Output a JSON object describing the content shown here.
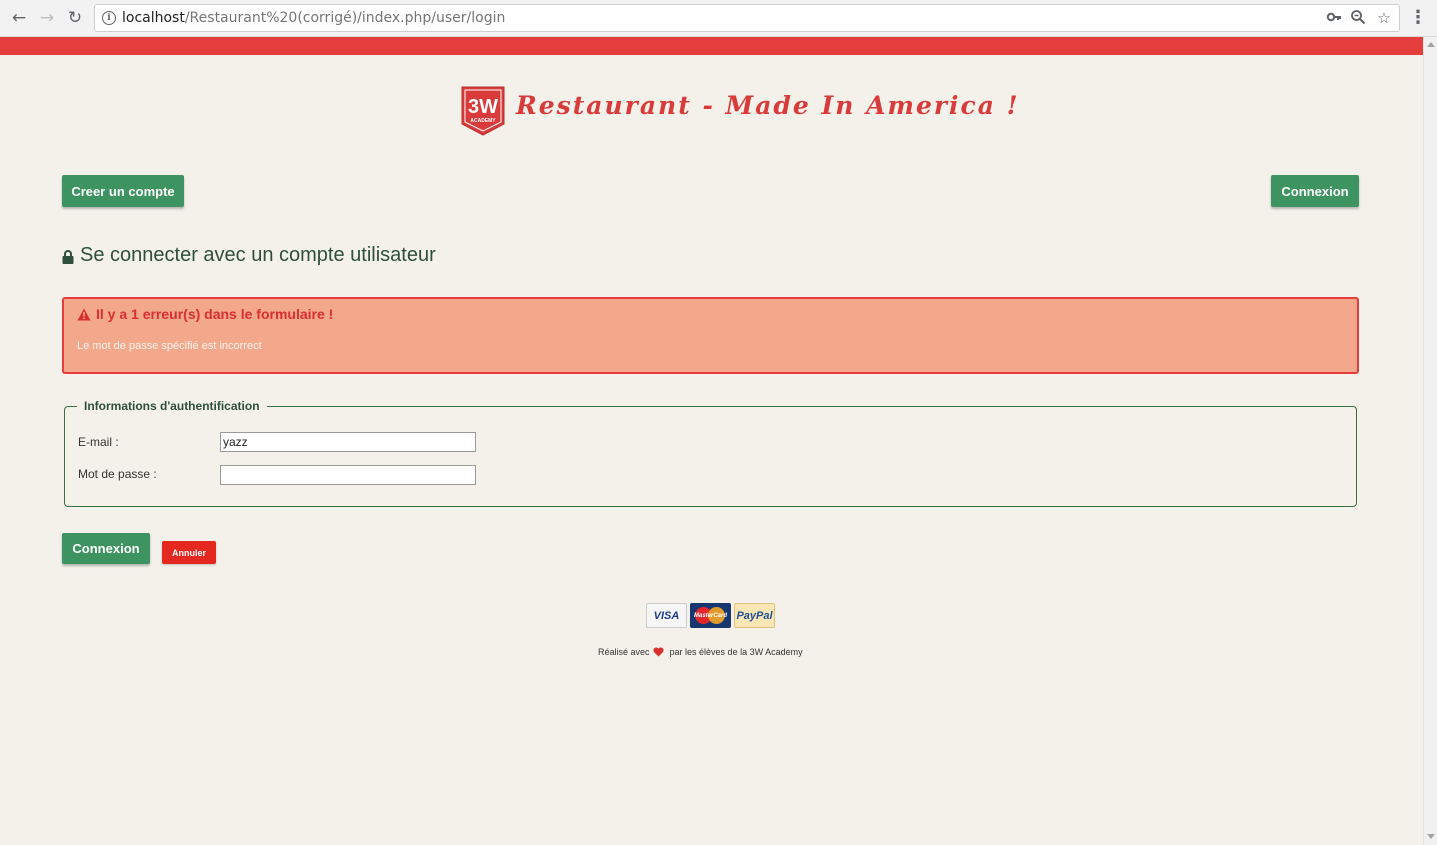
{
  "browser": {
    "url_host": "localhost",
    "url_path": "/Restaurant%20(corrigé)/index.php/user/login"
  },
  "header": {
    "logo_text": "3W",
    "logo_subtext": "ACADEMY",
    "title": "Restaurant - Made In America !"
  },
  "nav": {
    "create_account_label": "Creer un compte",
    "login_label": "Connexion"
  },
  "page": {
    "heading": "Se connecter avec un compte utilisateur"
  },
  "error": {
    "title": "Il y a 1 erreur(s) dans le formulaire !",
    "message": "Le mot de passe spécifié est incorrect"
  },
  "form": {
    "legend": "Informations d'authentification",
    "email_label": "E-mail :",
    "email_value": "yazz",
    "password_label": "Mot de passe :",
    "password_value": "",
    "submit_label": "Connexion",
    "cancel_label": "Annuler"
  },
  "footer": {
    "payments": [
      "VISA",
      "MasterCard",
      "PayPal"
    ],
    "credit_before": "Réalisé avec",
    "credit_after": "par les élèves de la 3W Academy"
  },
  "colors": {
    "accent_red": "#e53c3c",
    "button_green": "#3d9460",
    "error_bg": "#f3a78b",
    "page_bg": "#f3f1ea"
  }
}
